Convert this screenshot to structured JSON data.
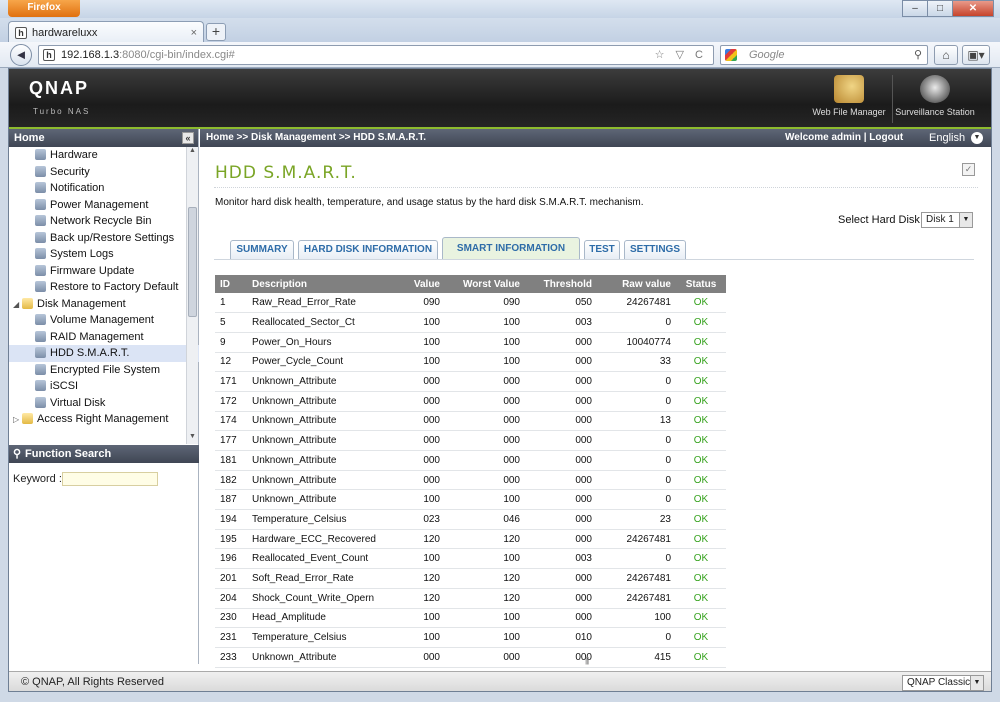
{
  "browser": {
    "app_button": "Firefox",
    "window_controls": [
      "–",
      "□",
      "✕"
    ],
    "tab_title": "hardwareluxx",
    "tab_close": "×",
    "new_tab": "+",
    "back": "◄",
    "url_host": "192.168.1.3",
    "url_rest": ":8080/cgi-bin/index.cgi#",
    "url_icons": "☆ ▽ C",
    "search_placeholder": "Google",
    "search_icon": "⚲",
    "home": "⌂",
    "addons": "▣▾"
  },
  "header": {
    "logo": "QNAP",
    "subtitle": "Turbo NAS",
    "apps": [
      {
        "label": "Web File Manager",
        "icon": "folder-magnifier-icon"
      },
      {
        "label": "Surveillance Station",
        "icon": "camera-icon"
      }
    ]
  },
  "sidebar": {
    "title": "Home",
    "collapse": "«",
    "items": [
      {
        "label": "Hardware",
        "level": "sub"
      },
      {
        "label": "Security",
        "level": "sub"
      },
      {
        "label": "Notification",
        "level": "sub"
      },
      {
        "label": "Power Management",
        "level": "sub"
      },
      {
        "label": "Network Recycle Bin",
        "level": "sub"
      },
      {
        "label": "Back up/Restore Settings",
        "level": "sub"
      },
      {
        "label": "System Logs",
        "level": "sub"
      },
      {
        "label": "Firmware Update",
        "level": "sub"
      },
      {
        "label": "Restore to Factory Default",
        "level": "sub"
      },
      {
        "label": "Disk Management",
        "level": "top",
        "expand": "◢"
      },
      {
        "label": "Volume Management",
        "level": "sub"
      },
      {
        "label": "RAID Management",
        "level": "sub"
      },
      {
        "label": "HDD S.M.A.R.T.",
        "level": "sub",
        "selected": true
      },
      {
        "label": "Encrypted File System",
        "level": "sub"
      },
      {
        "label": "iSCSI",
        "level": "sub"
      },
      {
        "label": "Virtual Disk",
        "level": "sub"
      },
      {
        "label": "Access Right Management",
        "level": "top",
        "expand": "▷"
      }
    ],
    "function_search": "Function Search",
    "keyword_label": "Keyword :"
  },
  "main": {
    "breadcrumb": "Home >> Disk Management >> HDD S.M.A.R.T.",
    "welcome": "Welcome admin | Logout",
    "language": "English",
    "title": "HDD S.M.A.R.T.",
    "description": "Monitor hard disk health, temperature, and usage status by the hard disk S.M.A.R.T. mechanism.",
    "select_label": "Select Hard Disk",
    "selected_disk": "Disk 1",
    "tabs": [
      {
        "label": "SUMMARY"
      },
      {
        "label": "HARD DISK INFORMATION"
      },
      {
        "label": "SMART INFORMATION",
        "active": true
      },
      {
        "label": "TEST"
      },
      {
        "label": "SETTINGS"
      }
    ],
    "columns": [
      "ID",
      "Description",
      "Value",
      "Worst Value",
      "Threshold",
      "Raw value",
      "Status"
    ],
    "rows": [
      [
        "1",
        "Raw_Read_Error_Rate",
        "090",
        "090",
        "050",
        "24267481",
        "OK"
      ],
      [
        "5",
        "Reallocated_Sector_Ct",
        "100",
        "100",
        "003",
        "0",
        "OK"
      ],
      [
        "9",
        "Power_On_Hours",
        "100",
        "100",
        "000",
        "10040774",
        "OK"
      ],
      [
        "12",
        "Power_Cycle_Count",
        "100",
        "100",
        "000",
        "33",
        "OK"
      ],
      [
        "171",
        "Unknown_Attribute",
        "000",
        "000",
        "000",
        "0",
        "OK"
      ],
      [
        "172",
        "Unknown_Attribute",
        "000",
        "000",
        "000",
        "0",
        "OK"
      ],
      [
        "174",
        "Unknown_Attribute",
        "000",
        "000",
        "000",
        "13",
        "OK"
      ],
      [
        "177",
        "Unknown_Attribute",
        "000",
        "000",
        "000",
        "0",
        "OK"
      ],
      [
        "181",
        "Unknown_Attribute",
        "000",
        "000",
        "000",
        "0",
        "OK"
      ],
      [
        "182",
        "Unknown_Attribute",
        "000",
        "000",
        "000",
        "0",
        "OK"
      ],
      [
        "187",
        "Unknown_Attribute",
        "100",
        "100",
        "000",
        "0",
        "OK"
      ],
      [
        "194",
        "Temperature_Celsius",
        "023",
        "046",
        "000",
        "23",
        "OK"
      ],
      [
        "195",
        "Hardware_ECC_Recovered",
        "120",
        "120",
        "000",
        "24267481",
        "OK"
      ],
      [
        "196",
        "Reallocated_Event_Count",
        "100",
        "100",
        "003",
        "0",
        "OK"
      ],
      [
        "201",
        "Soft_Read_Error_Rate",
        "120",
        "120",
        "000",
        "24267481",
        "OK"
      ],
      [
        "204",
        "Shock_Count_Write_Opern",
        "120",
        "120",
        "000",
        "24267481",
        "OK"
      ],
      [
        "230",
        "Head_Amplitude",
        "100",
        "100",
        "000",
        "100",
        "OK"
      ],
      [
        "231",
        "Temperature_Celsius",
        "100",
        "100",
        "010",
        "0",
        "OK"
      ],
      [
        "233",
        "Unknown_Attribute",
        "000",
        "000",
        "000",
        "415",
        "OK"
      ]
    ],
    "status_color": "#36a21e"
  },
  "footer": {
    "copyright": "© QNAP, All Rights Reserved",
    "theme": "QNAP Classic"
  }
}
